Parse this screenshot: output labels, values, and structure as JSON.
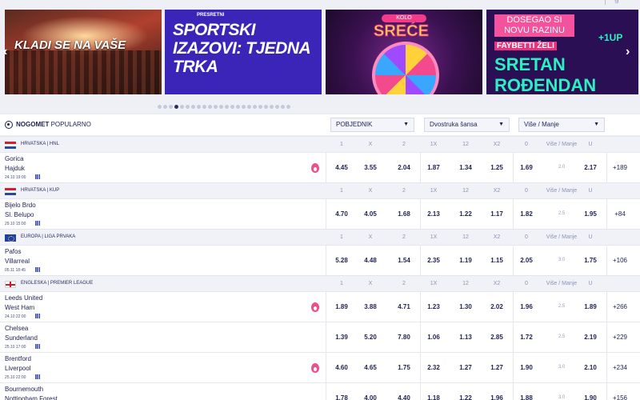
{
  "top": {
    "right_text": "g"
  },
  "carousel": {
    "banners": [
      {
        "name": "kladi-se-banner",
        "text": "KLADI SE NA VAŠE"
      },
      {
        "name": "sportski-izazovi-banner",
        "kicker": "PRESRETNI",
        "text": "SPORTSKI IZAZOVI: TJEDNA TRKA"
      },
      {
        "name": "kolo-srece-banner",
        "badge": "KOLO",
        "text": "SREĆE"
      },
      {
        "name": "sretan-rodendan-banner",
        "text1": "DOSEGAO SI NOVU RAZINU",
        "text2": "FAYBETTI ŽELI",
        "text3": "SRETAN ROĐENDAN",
        "plus": "+1UP"
      }
    ],
    "arrow_left": "‹",
    "arrow_right": "›",
    "dot_count": 24,
    "active_dot": 3
  },
  "section": {
    "sport": "NOGOMET",
    "category": "POPULARNO",
    "selects": [
      {
        "label": "POBJEDNIK",
        "caret": "▼"
      },
      {
        "label": "Dvostruka šansa",
        "caret": "▼"
      },
      {
        "label": "Više / Manje",
        "caret": "▼"
      }
    ]
  },
  "headers": [
    "1",
    "X",
    "2",
    "1X",
    "12",
    "X2",
    "0",
    "Više / Manje",
    "U"
  ],
  "leagues": [
    {
      "flag": "hr",
      "name": "HRVATSKA | HNL",
      "matches": [
        {
          "home": "Gorica",
          "away": "Hajduk",
          "date": "24.10",
          "time": "19:00",
          "hot": true,
          "odds": [
            "4.45",
            "3.55",
            "2.04",
            "1.87",
            "1.34",
            "1.25",
            "1.69",
            "2.0",
            "2.17"
          ],
          "more": "+189"
        }
      ]
    },
    {
      "flag": "hr",
      "name": "HRVATSKA | KUP",
      "matches": [
        {
          "home": "Bijelo Brdo",
          "away": "Sl. Belupo",
          "date": "29.10",
          "time": "15:00",
          "hot": false,
          "odds": [
            "4.70",
            "4.05",
            "1.68",
            "2.13",
            "1.22",
            "1.17",
            "1.82",
            "2.5",
            "1.95"
          ],
          "more": "+84"
        }
      ]
    },
    {
      "flag": "eu",
      "name": "EUROPA | LIGA PRVAKA",
      "matches": [
        {
          "home": "Pafos",
          "away": "Villarreal",
          "date": "05.11",
          "time": "18:45",
          "hot": false,
          "odds": [
            "5.28",
            "4.48",
            "1.54",
            "2.35",
            "1.19",
            "1.15",
            "2.05",
            "3.0",
            "1.75"
          ],
          "more": "+106"
        }
      ]
    },
    {
      "flag": "en",
      "name": "ENGLESKA | PREMIER LEAGUE",
      "matches": [
        {
          "home": "Leeds United",
          "away": "West Ham",
          "date": "24.10",
          "time": "22:00",
          "hot": true,
          "odds": [
            "1.89",
            "3.88",
            "4.71",
            "1.23",
            "1.30",
            "2.02",
            "1.96",
            "2.5",
            "1.89"
          ],
          "more": "+266"
        },
        {
          "home": "Chelsea",
          "away": "Sunderland",
          "date": "25.10",
          "time": "17:00",
          "hot": false,
          "odds": [
            "1.39",
            "5.20",
            "7.80",
            "1.06",
            "1.13",
            "2.85",
            "1.72",
            "2.5",
            "2.19"
          ],
          "more": "+229"
        },
        {
          "home": "Brentford",
          "away": "Liverpool",
          "date": "25.10",
          "time": "22:00",
          "hot": true,
          "odds": [
            "4.60",
            "4.65",
            "1.75",
            "2.32",
            "1.27",
            "1.27",
            "1.90",
            "3.0",
            "2.10"
          ],
          "more": "+234"
        },
        {
          "home": "Bournemouth",
          "away": "Nottingham Forest",
          "date": "",
          "time": "",
          "hot": false,
          "odds": [
            "1.78",
            "4.00",
            "4.40",
            "1.18",
            "1.22",
            "1.96",
            "1.88",
            "3.0",
            "1.90"
          ],
          "more": "+156"
        }
      ]
    }
  ]
}
